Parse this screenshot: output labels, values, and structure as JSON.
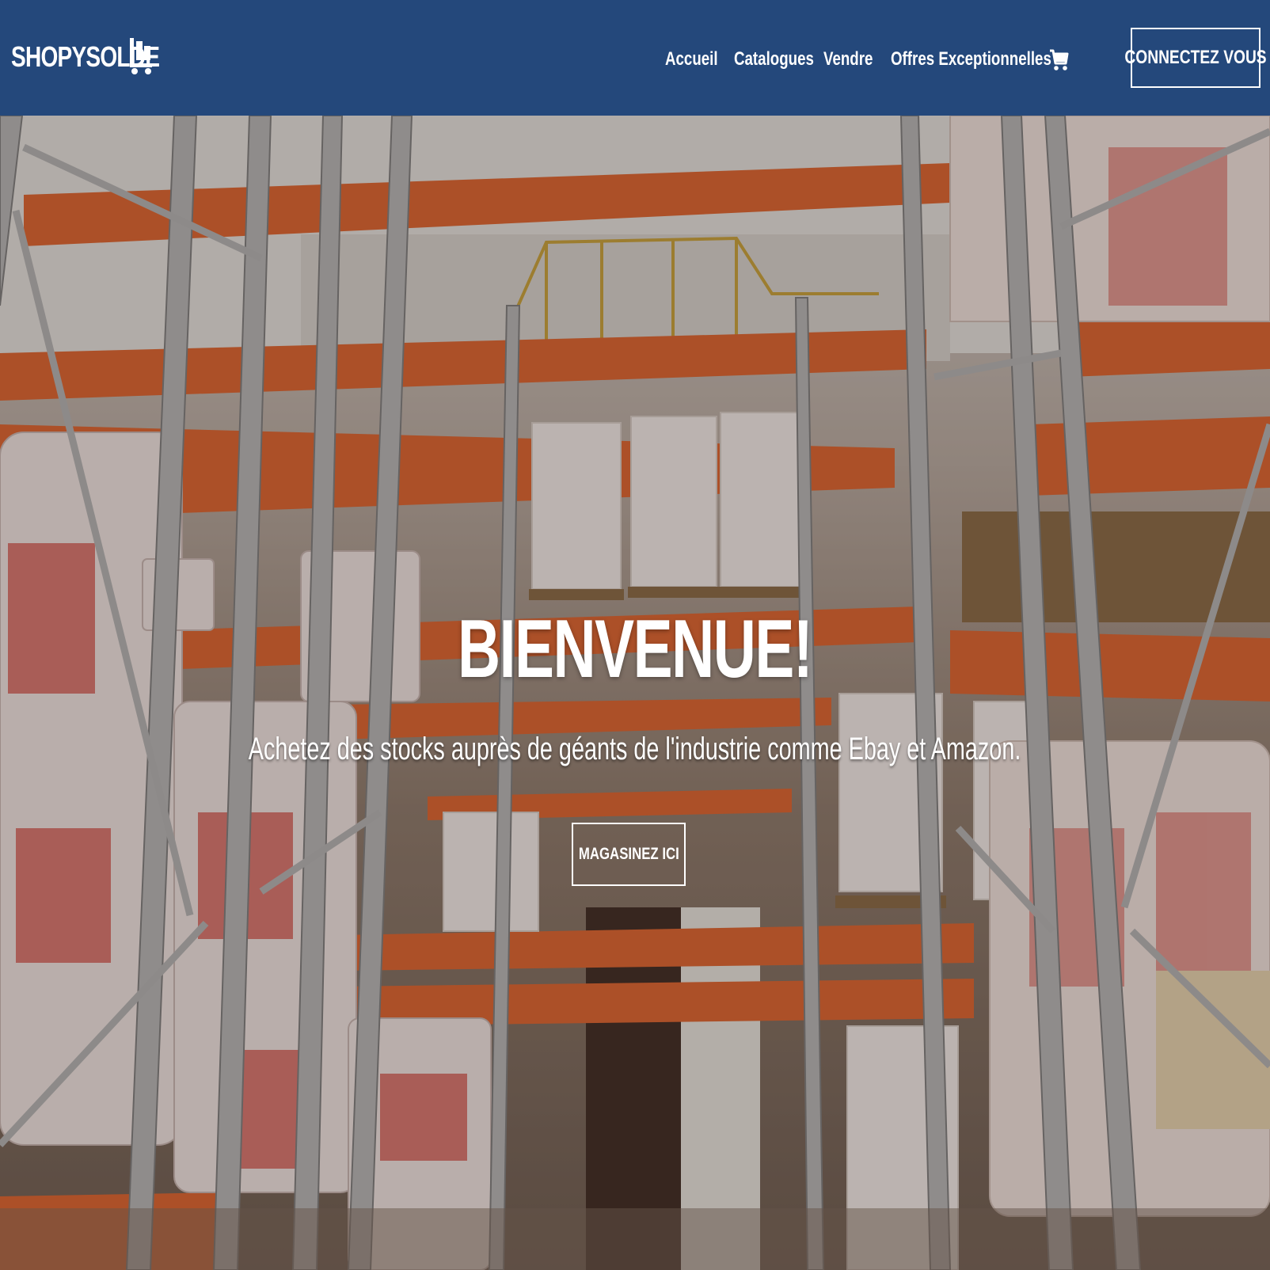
{
  "brand": {
    "name": "SHOPYSOLDE",
    "icon": "shopping-cart-logo-icon"
  },
  "nav": {
    "items": [
      {
        "label": "Accueil"
      },
      {
        "label": "Catalogues"
      },
      {
        "label": "Vendre"
      },
      {
        "label": "Offres Exceptionnelles"
      }
    ],
    "cart_icon": "shopping-cart-icon",
    "login_label": "CONNECTEZ VOUS"
  },
  "hero": {
    "title": "BIENVENUE!",
    "subtitle": "Achetez des stocks auprès de géants de l'industrie comme Ebay et Amazon.",
    "cta_label": "MAGASINEZ ICI",
    "background": "warehouse-shelves-image"
  },
  "colors": {
    "navbar": "#24487b",
    "text": "#ffffff",
    "shelf_orange": "#e0652f",
    "rack_steel": "#b8b8b8"
  }
}
